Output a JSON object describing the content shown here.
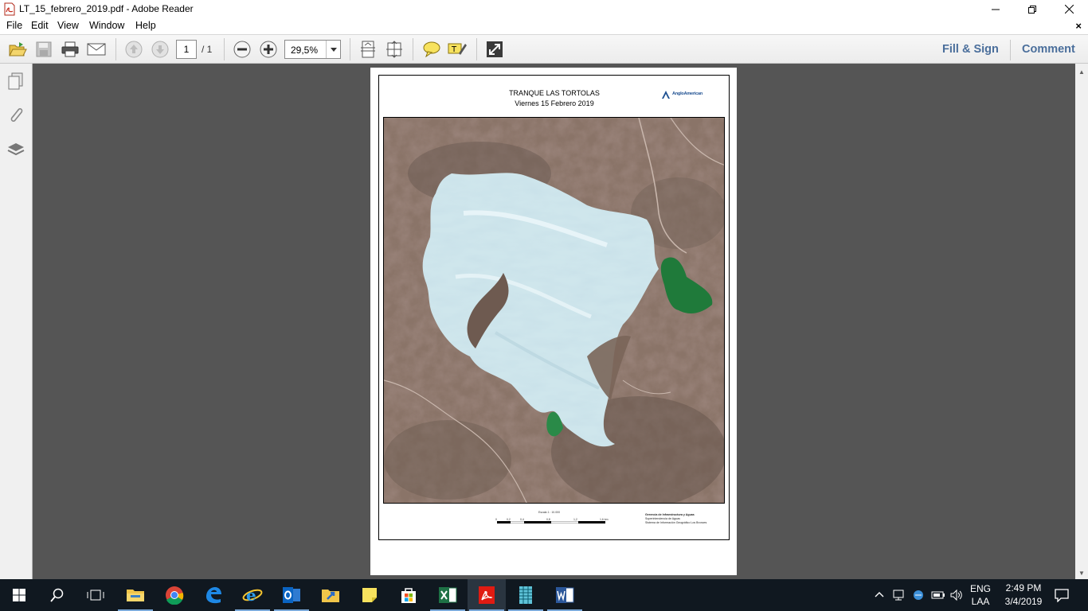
{
  "window": {
    "title": "LT_15_febrero_2019.pdf - Adobe Reader",
    "doc_close": "×"
  },
  "menu": {
    "items": [
      "File",
      "Edit",
      "View",
      "Window",
      "Help"
    ]
  },
  "toolbar": {
    "page_current": "1",
    "page_total": "/ 1",
    "zoom": "29,5%",
    "fill_sign": "Fill & Sign",
    "comment": "Comment"
  },
  "pdf": {
    "title": "TRANQUE LAS TORTOLAS",
    "date": "Viernes 15 Febrero 2019",
    "logo": "AngloAmerican",
    "scale_label": "Escala 1 : 10.000",
    "scale_ticks": [
      "0",
      "0,2",
      "0,4",
      "0,8",
      "1,2",
      "1,6 km"
    ],
    "credits": [
      "Gerencia de Infraestructura y Aguas",
      "Superintendencia de Aguas",
      "Sistema de Información Geográfico Los Bronces"
    ]
  },
  "taskbar": {
    "language": "ENG",
    "layout": "LAA",
    "time": "2:49 PM",
    "date": "3/4/2019"
  },
  "colors": {
    "accent_link": "#4a6e9b",
    "doc_bg": "#555555",
    "taskbar": "#101820"
  }
}
